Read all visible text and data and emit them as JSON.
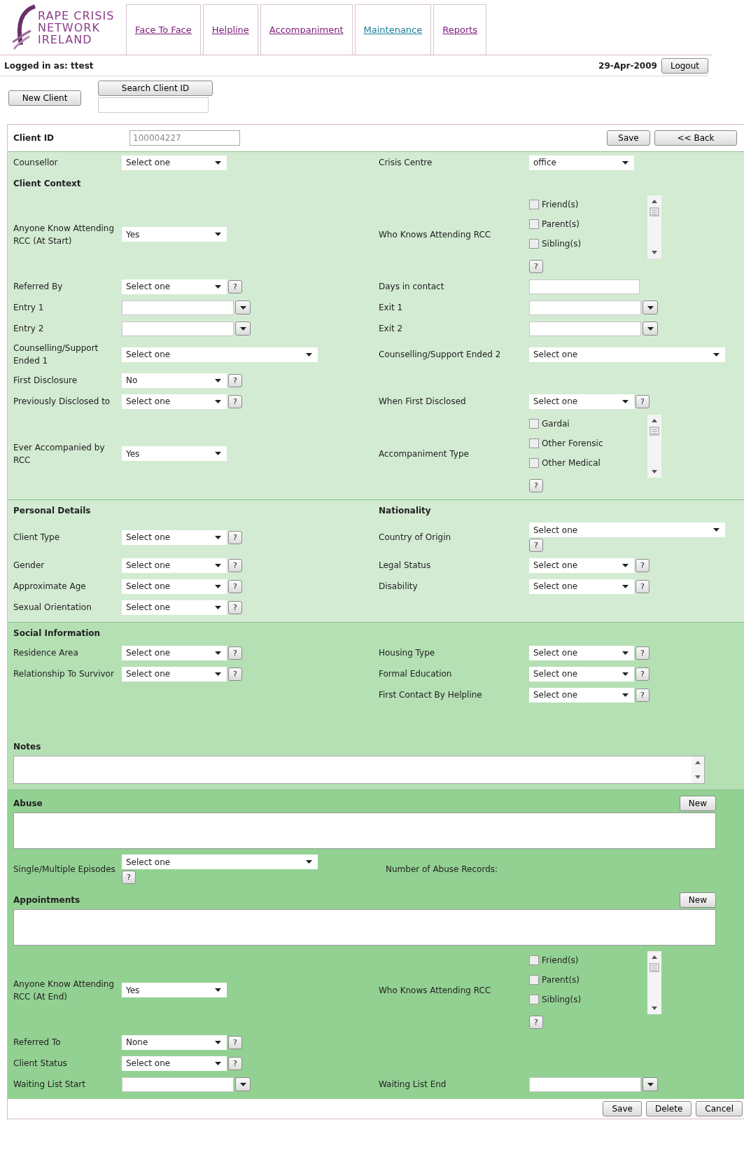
{
  "logo": {
    "lines": [
      "RAPE CRISIS",
      "NETWORK",
      "IRELAND"
    ]
  },
  "tabs": [
    {
      "label": "Face To Face",
      "visited": true
    },
    {
      "label": "Helpline",
      "visited": true
    },
    {
      "label": "Accompaniment",
      "visited": true
    },
    {
      "label": "Maintenance",
      "visited": false
    },
    {
      "label": "Reports",
      "visited": true
    }
  ],
  "user_bar": {
    "logged_in": "Logged in as: ttest",
    "date": "29-Apr-2009",
    "logout": "Logout"
  },
  "toolbar": {
    "new_client": "New Client",
    "search": "Search Client ID"
  },
  "client_id": {
    "label": "Client ID",
    "value": "100004227",
    "save": "Save",
    "back": "<< Back"
  },
  "sections": [
    {
      "color": "#d3ebd3",
      "rows": [
        {
          "kind": "fields",
          "cells": [
            {
              "kind": "select",
              "label": "Counsellor",
              "value": "Select one"
            },
            {
              "kind": "select",
              "label": "Crisis Centre",
              "value": "office"
            }
          ]
        },
        {
          "kind": "heading",
          "texts": [
            "Client Context"
          ]
        },
        {
          "kind": "fields",
          "cells": [
            {
              "kind": "select",
              "label": "Anyone Know Attending RCC (At Start)",
              "value": "Yes"
            },
            {
              "kind": "checklist",
              "label": "Who Knows Attending RCC",
              "options": [
                {
                  "label": "Friend(s)",
                  "checked": false
                },
                {
                  "label": "Parent(s)",
                  "checked": false
                },
                {
                  "label": "Sibling(s)",
                  "checked": false
                }
              ],
              "help": "?"
            }
          ]
        },
        {
          "kind": "fields",
          "cells": [
            {
              "kind": "select",
              "label": "Referred By",
              "value": "Select one",
              "help": "?"
            },
            {
              "kind": "text",
              "label": "Days in contact"
            }
          ]
        },
        {
          "kind": "fields",
          "cells": [
            {
              "kind": "date",
              "label": "Entry 1"
            },
            {
              "kind": "date",
              "label": "Exit 1"
            }
          ]
        },
        {
          "kind": "fields",
          "cells": [
            {
              "kind": "date",
              "label": "Entry 2"
            },
            {
              "kind": "date",
              "label": "Exit 2"
            }
          ]
        },
        {
          "kind": "fields",
          "cells": [
            {
              "kind": "wide_select",
              "label": "Counselling/Support Ended 1",
              "value": "Select one"
            },
            {
              "kind": "wide_select",
              "label": "Counselling/Support Ended 2",
              "value": "Select one"
            }
          ]
        },
        {
          "kind": "fields",
          "cells": [
            {
              "kind": "select",
              "label": "First Disclosure",
              "value": "No",
              "help": "?"
            },
            null
          ]
        },
        {
          "kind": "fields",
          "cells": [
            {
              "kind": "select",
              "label": "Previously Disclosed to",
              "value": "Select one",
              "help": "?"
            },
            {
              "kind": "select",
              "label": "When First Disclosed",
              "value": "Select one",
              "help": "?"
            }
          ]
        },
        {
          "kind": "fields",
          "cells": [
            {
              "kind": "select",
              "label": "Ever Accompanied by RCC",
              "value": "Yes"
            },
            {
              "kind": "checklist",
              "label": "Accompaniment Type",
              "options": [
                {
                  "label": "Gardai",
                  "checked": false
                },
                {
                  "label": "Other Forensic",
                  "checked": false
                },
                {
                  "label": "Other Medical",
                  "checked": false
                }
              ],
              "help": "?"
            }
          ]
        }
      ]
    },
    {
      "color": "#d3ebd3",
      "rows": [
        {
          "kind": "heading",
          "texts": [
            "Personal Details",
            "Nationality"
          ]
        },
        {
          "kind": "fields",
          "cells": [
            {
              "kind": "select",
              "label": "Client Type",
              "value": "Select one",
              "help": "?"
            },
            {
              "kind": "wide_select",
              "label": "Country of Origin",
              "value": "Select one",
              "help": "?"
            }
          ]
        },
        {
          "kind": "fields",
          "cells": [
            {
              "kind": "select",
              "label": "Gender",
              "value": "Select one",
              "help": "?"
            },
            {
              "kind": "select",
              "label": "Legal Status",
              "value": "Select one",
              "help": "?"
            }
          ]
        },
        {
          "kind": "fields",
          "cells": [
            {
              "kind": "select",
              "label": "Approximate Age",
              "value": "Select one",
              "help": "?"
            },
            {
              "kind": "select",
              "label": "Disability",
              "value": "Select one",
              "help": "?"
            }
          ]
        },
        {
          "kind": "fields",
          "cells": [
            {
              "kind": "select",
              "label": "Sexual Orientation",
              "value": "Select one",
              "help": "?"
            },
            null
          ]
        }
      ]
    },
    {
      "color": "#b4e0b4",
      "rows": [
        {
          "kind": "heading",
          "texts": [
            "Social Information"
          ]
        },
        {
          "kind": "fields",
          "cells": [
            {
              "kind": "select",
              "label": "Residence Area",
              "value": "Select one",
              "help": "?"
            },
            {
              "kind": "select",
              "label": "Housing Type",
              "value": "Select one",
              "help": "?"
            }
          ]
        },
        {
          "kind": "fields",
          "cells": [
            {
              "kind": "select",
              "label": "Relationship To Survivor",
              "value": "Select one",
              "help": "?"
            },
            {
              "kind": "select",
              "label": "Formal Education",
              "value": "Select one",
              "help": "?"
            }
          ]
        },
        {
          "kind": "fields",
          "cells": [
            null,
            {
              "kind": "select",
              "label": "First Contact By Helpline",
              "value": "Select one",
              "help": "?"
            }
          ]
        },
        {
          "kind": "textarea",
          "label": "Notes"
        }
      ]
    },
    {
      "color": "#93d193",
      "rows": [
        {
          "kind": "list_box",
          "label": "Abuse",
          "button": "New"
        },
        {
          "kind": "fields",
          "cells": [
            {
              "kind": "wide_select",
              "label": "Single/Multiple Episodes",
              "value": "Select one",
              "help": "?"
            },
            {
              "kind": "note",
              "label": "Number of Abuse Records:"
            }
          ]
        },
        {
          "kind": "list_box",
          "label": "Appointments",
          "button": "New"
        },
        {
          "kind": "fields",
          "cells": [
            {
              "kind": "select",
              "label": "Anyone Know Attending RCC (At End)",
              "value": "Yes"
            },
            {
              "kind": "checklist",
              "label": "Who Knows Attending RCC",
              "options": [
                {
                  "label": "Friend(s)",
                  "checked": false
                },
                {
                  "label": "Parent(s)",
                  "checked": false
                },
                {
                  "label": "Sibling(s)",
                  "checked": false
                }
              ],
              "help": "?"
            }
          ]
        },
        {
          "kind": "fields",
          "cells": [
            {
              "kind": "select",
              "label": "Referred To",
              "value": "None",
              "help": "?"
            },
            null
          ]
        },
        {
          "kind": "fields",
          "cells": [
            {
              "kind": "select",
              "label": "Client Status",
              "value": "Select one",
              "help": "?"
            },
            null
          ]
        },
        {
          "kind": "fields",
          "cells": [
            {
              "kind": "date",
              "label": "Waiting List Start"
            },
            {
              "kind": "date",
              "label": "Waiting List End"
            }
          ]
        }
      ]
    }
  ],
  "footer_buttons": [
    "Save",
    "Delete",
    "Cancel"
  ]
}
